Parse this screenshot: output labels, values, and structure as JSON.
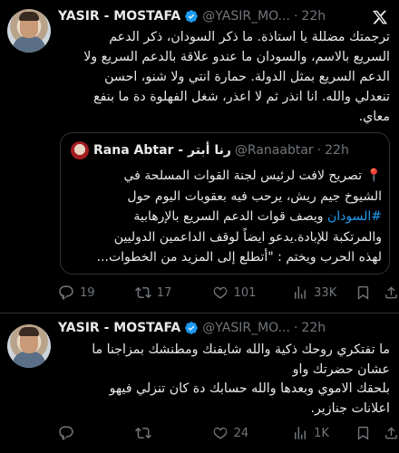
{
  "tweet1": {
    "author_name": "YASIR - MOSTAFA",
    "handle": "@YASIR_MO...",
    "separator": "·",
    "time": "22h",
    "lines": [
      "ترجمتك مضللة يا استاذة. ما ذكر السودان، ذكر الدعم",
      "السريع بالاسم، والسودان ما عندو علاقة بالدعم السريع ولا",
      "الدعم السريع بمثل الدولة. حمارة انتي ولا شنو، احسن",
      "تنعدلي والله. انا انذر ثم لا اعذر، شغل الفهلوة دة ما بنفع",
      "معاي."
    ],
    "quote": {
      "author_name": "Rana Abtar - رنا أبتر",
      "handle": "@Ranaabtar",
      "separator": "·",
      "time": "22h",
      "pin": "📍",
      "line1": "تصريح لافت لرئيس لجنة القوات المسلحة في",
      "line2": "الشيوخ جيم ريش، يرحب فيه بعقوبات اليوم حول",
      "hashtag": "#السودان",
      "line3_rest": " ويصف قوات الدعم السريع بالإرهابية",
      "line4": "والمرتكبة للإبادة.يدعو ايضاً لوقف الداعمين الدوليين",
      "line5": "لهذه الحرب ويختم : \"أتطلع إلى المزيد من الخطوات..."
    },
    "actions": {
      "replies": "19",
      "reposts": "17",
      "likes": "101",
      "views": "33K"
    }
  },
  "tweet2": {
    "author_name": "YASIR - MOSTAFA",
    "handle": "@YASIR_MO...",
    "separator": "·",
    "time": "22h",
    "lines": [
      "ما تفتكري روحك ذكية والله شايفنك ومطنشك بمزاجنا ما",
      "عشان حضرتك واو",
      "بلحقك الاموي وبعدها والله حسابك دة كان تنزلي فيهو",
      "اعلانات جنازير."
    ],
    "actions": {
      "replies": "",
      "reposts": "",
      "likes": "24",
      "views": "1K"
    }
  },
  "icons": {
    "verified": "verified-badge-icon",
    "x_logo": "x-logo-icon",
    "reply": "reply-icon",
    "repost": "repost-icon",
    "like": "heart-icon",
    "views": "analytics-icon"
  },
  "colors": {
    "background": "#000000",
    "text": "#e7e9ea",
    "muted": "#71767b",
    "accent": "#1d9bf0",
    "border": "#2f3336"
  }
}
